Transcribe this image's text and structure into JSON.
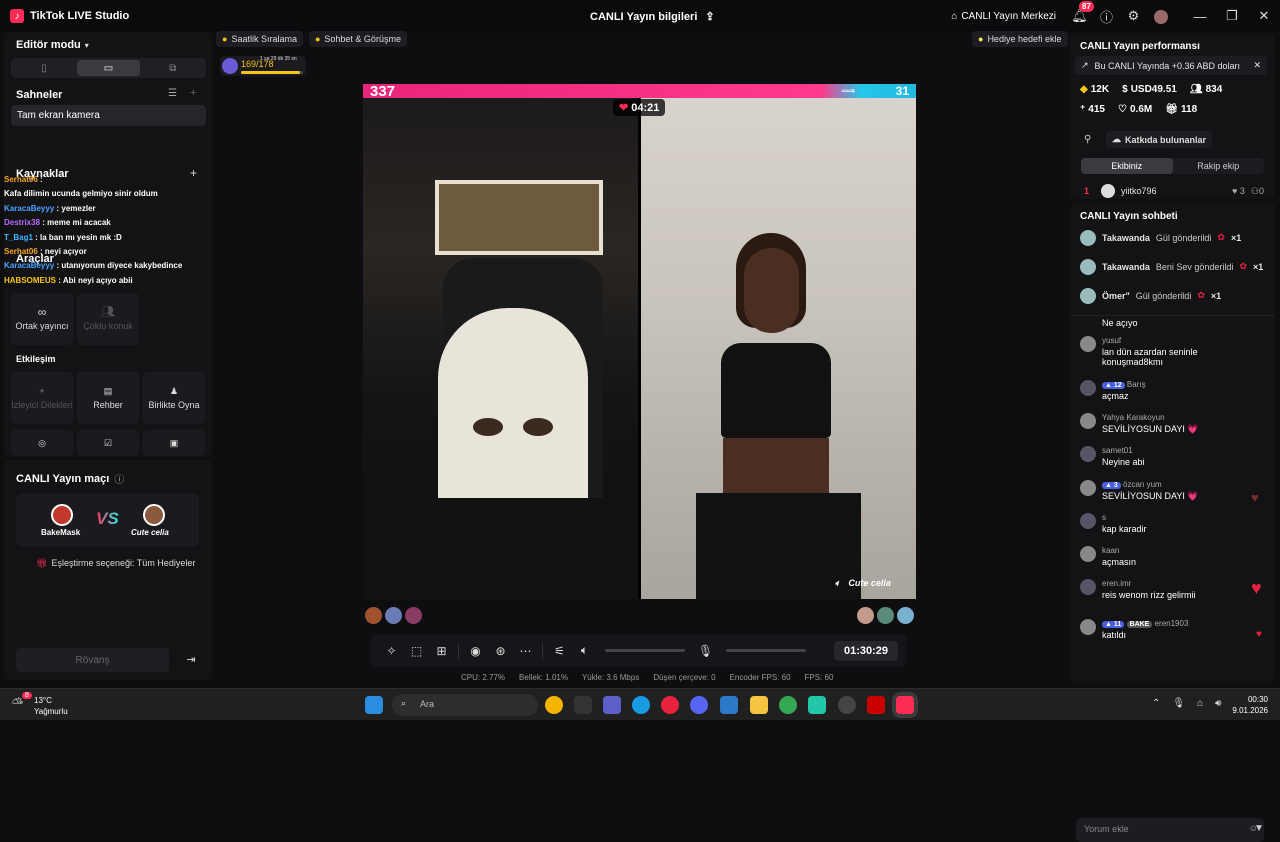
{
  "app": {
    "title": "TikTok LIVE Studio",
    "center_title": "CANLI Yayın bilgileri",
    "live_center": "CANLI Yayın Merkezi",
    "notif_count": "87"
  },
  "left": {
    "editor_mode": "Editör modu",
    "scenes_title": "Sahneler",
    "scene_item": "Tam ekran kamera",
    "sources_title": "Kaynaklar",
    "tools_title": "Araçlar",
    "overlay_chat": [
      {
        "user": "Serhat06",
        "text": "",
        "ucolor": "#f5a623"
      },
      {
        "user": "",
        "text": "Kafa dilimin ucunda gelmiyo sinir oldum",
        "ucolor": "#3fb6ff"
      },
      {
        "user": "KaracaBeyyy",
        "text": "yemezler",
        "ucolor": "#4aa3ff"
      },
      {
        "user": "Destrix38",
        "text": "meme mi acacak",
        "ucolor": "#b56bff"
      },
      {
        "user": "T_Bag1",
        "text": "la ban mı yesin mk :D",
        "ucolor": "#3fb6ff"
      },
      {
        "user": "Serhat06",
        "text": "neyi açıyor",
        "ucolor": "#f5a623"
      },
      {
        "user": "KaracaBeyyy",
        "text": "utanıyorum diyece kakybedince",
        "ucolor": "#4aa3ff"
      },
      {
        "user": "HABSOMEUS",
        "text": "Abi neyi açıyo abii",
        "ucolor": "#f5c518"
      }
    ],
    "tools": [
      {
        "label": "Ortak yayıncı",
        "icon": "link-icon",
        "dim": false
      },
      {
        "label": "Çoklu konuk",
        "icon": "users-icon",
        "dim": true
      }
    ],
    "interaction_title": "Etkileşim",
    "interactions": [
      {
        "label": "İzleyici Dilekleri",
        "icon": "wish-icon",
        "dim": true
      },
      {
        "label": "Rehber",
        "icon": "guide-icon",
        "dim": false
      },
      {
        "label": "Birlikte Oyna",
        "icon": "play-together-icon",
        "dim": false
      }
    ],
    "match_title": "CANLI Yayın maçı",
    "player1": "BakeMask",
    "player2": "Cute celia",
    "vs": "VS",
    "match_option": "Eşleştirme seçeneği: Tüm Hediyeler",
    "rematch": "Rövanş"
  },
  "center": {
    "chip1": "Saatlik Sıralama",
    "chip2": "Sohbet & Görüşme",
    "gift_goal": "Hediye hedefi ekle",
    "progress_text": "169/178",
    "progress_sub": "1 sa 29 dk 35 sn",
    "progress_fraction": 0.95,
    "score_left": "337",
    "score_right": "31",
    "battle_timer": "04:21",
    "right_name": "Cute celia",
    "live_time": "01:30:29"
  },
  "stats": {
    "cpu": "CPU:  2.77%",
    "mem": "Bellek:  1.01%",
    "upload": "Yükle:  3.6 Mbps",
    "drop": "Düşen çerçeve:  0",
    "enc": "Encoder FPS:  60",
    "fps": "FPS:  60"
  },
  "right": {
    "perf_title": "CANLI Yayın performansı",
    "perf_pill": "Bu CANLI Yayında +0.36 ABD doları",
    "m1": "12K",
    "m2": "USD49.51",
    "m3": "834",
    "m4": "415",
    "m5": "0.6M",
    "m6": "118",
    "contrib_btn": "Katkıda bulunanlar",
    "tab_ours": "Ekibiniz",
    "tab_rival": "Rakip ekip",
    "rank_no": "1",
    "rank_user": "yiitko796",
    "rank_hearts": "3",
    "rank_zero": "0",
    "chat_title": "CANLI Yayın sohbeti",
    "gifts": [
      {
        "user": "Takawanda",
        "text": "Gül gönderildi",
        "count": "×1"
      },
      {
        "user": "Takawanda",
        "text": "Beni Sev gönderildi",
        "count": "×1"
      },
      {
        "user": "Ömer\"",
        "text": "Gül gönderildi",
        "count": "×1"
      }
    ],
    "comments": [
      {
        "name": "",
        "msg": "Ne açıyo"
      },
      {
        "name": "yusuf",
        "msg": "lan dün azardan seninle konuşmad8kmı"
      },
      {
        "name": "Barış",
        "msg": "açmaz",
        "level": "12"
      },
      {
        "name": "Yahya Karakoyun",
        "msg": "SEVİLİYOSUN DAYI 💗"
      },
      {
        "name": "samet01",
        "msg": "Neyine abi"
      },
      {
        "name": "özcan yum",
        "msg": "SEVİLİYOSUN DAYI 💗",
        "level": "3"
      },
      {
        "name": "s",
        "msg": "kap karadir"
      },
      {
        "name": "kaan",
        "msg": "açmasın"
      },
      {
        "name": "eren.imr",
        "msg": "reis wenom rizz gelirmii"
      },
      {
        "name": "eren1903",
        "msg": "katıldı",
        "level": "11",
        "badge": "BAKE"
      }
    ],
    "input_placeholder": "Yorum ekle"
  },
  "taskbar": {
    "temp": "13°C",
    "weather": "Yağmurlu",
    "search": "Ara",
    "time": "00:30",
    "date": "9.01.2026",
    "weather_badge": "8"
  }
}
